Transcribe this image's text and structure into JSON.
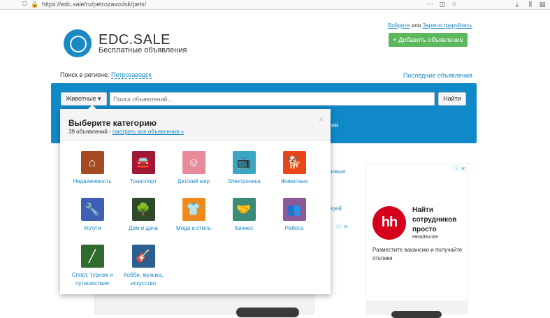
{
  "browser": {
    "url": "https://edc.sale/ru/petrozavodsk/pets/",
    "icons": [
      "shield-icon",
      "lock-icon",
      "more-icon",
      "pocket-icon",
      "star-icon",
      "download-icon",
      "library-icon",
      "sidebar-icon"
    ]
  },
  "header": {
    "logo_title": "EDC.SALE",
    "logo_subtitle": "Бесплатные объявления",
    "login_label": "Войдите",
    "or_label": "или",
    "register_label": "Зарегистрируйтесь",
    "add_button_label": "+ Добавить объявление"
  },
  "region": {
    "label": "Поиск в регионе:",
    "value": "Петрозаводск",
    "latest_link": "Последние объявления"
  },
  "search": {
    "category_value": "Животные ▾",
    "placeholder": "Поиск объявлений...",
    "button_label": "Найти",
    "panel_subtext": "ия"
  },
  "background": {
    "fragment1": "новые",
    "fragment2": "ерей",
    "ad_info_icon": "ⓘ ✕"
  },
  "popup": {
    "title": "Выберите категорию",
    "count_text": "39 объявлений -",
    "view_all_link": "смотреть все объявления »",
    "close_glyph": "×",
    "categories": [
      {
        "label": "Недвижимость",
        "icon": "house-icon",
        "glyph": "⌂",
        "color": "#a54a22"
      },
      {
        "label": "Транспорт",
        "icon": "car-icon",
        "glyph": "🚘",
        "color": "#a01838"
      },
      {
        "label": "Детский мир",
        "icon": "baby-icon",
        "glyph": "☺",
        "color": "#e88a9a"
      },
      {
        "label": "Электроника",
        "icon": "tv-icon",
        "glyph": "📺",
        "color": "#3aa6c4"
      },
      {
        "label": "Животные",
        "icon": "pets-icon",
        "glyph": "🐕",
        "color": "#e8461a"
      },
      {
        "label": "Услуги",
        "icon": "wrench-icon",
        "glyph": "🔧",
        "color": "#3f5fb6"
      },
      {
        "label": "Дом и дача",
        "icon": "tree-icon",
        "glyph": "🌳",
        "color": "#2f4a2a"
      },
      {
        "label": "Мода и стиль",
        "icon": "shirt-icon",
        "glyph": "👕",
        "color": "#f08a1c"
      },
      {
        "label": "Бизнес",
        "icon": "handshake-icon",
        "glyph": "🤝",
        "color": "#3c8a78"
      },
      {
        "label": "Работа",
        "icon": "people-icon",
        "glyph": "👥",
        "color": "#8c5a98"
      },
      {
        "label": "Спорт, туризм и путешествия",
        "icon": "rifle-icon",
        "glyph": "╱",
        "color": "#2e6b2c"
      },
      {
        "label": "Хобби, музыка, искусство",
        "icon": "guitar-icon",
        "glyph": "🎸",
        "color": "#2a5f8f"
      }
    ]
  },
  "ad": {
    "logo_text": "hh",
    "title": "Найти сотрудников просто",
    "brand": "HeadHunter",
    "text": "Разместите вакансию и получайте отклики",
    "info_icon": "ⓘ ✕"
  }
}
